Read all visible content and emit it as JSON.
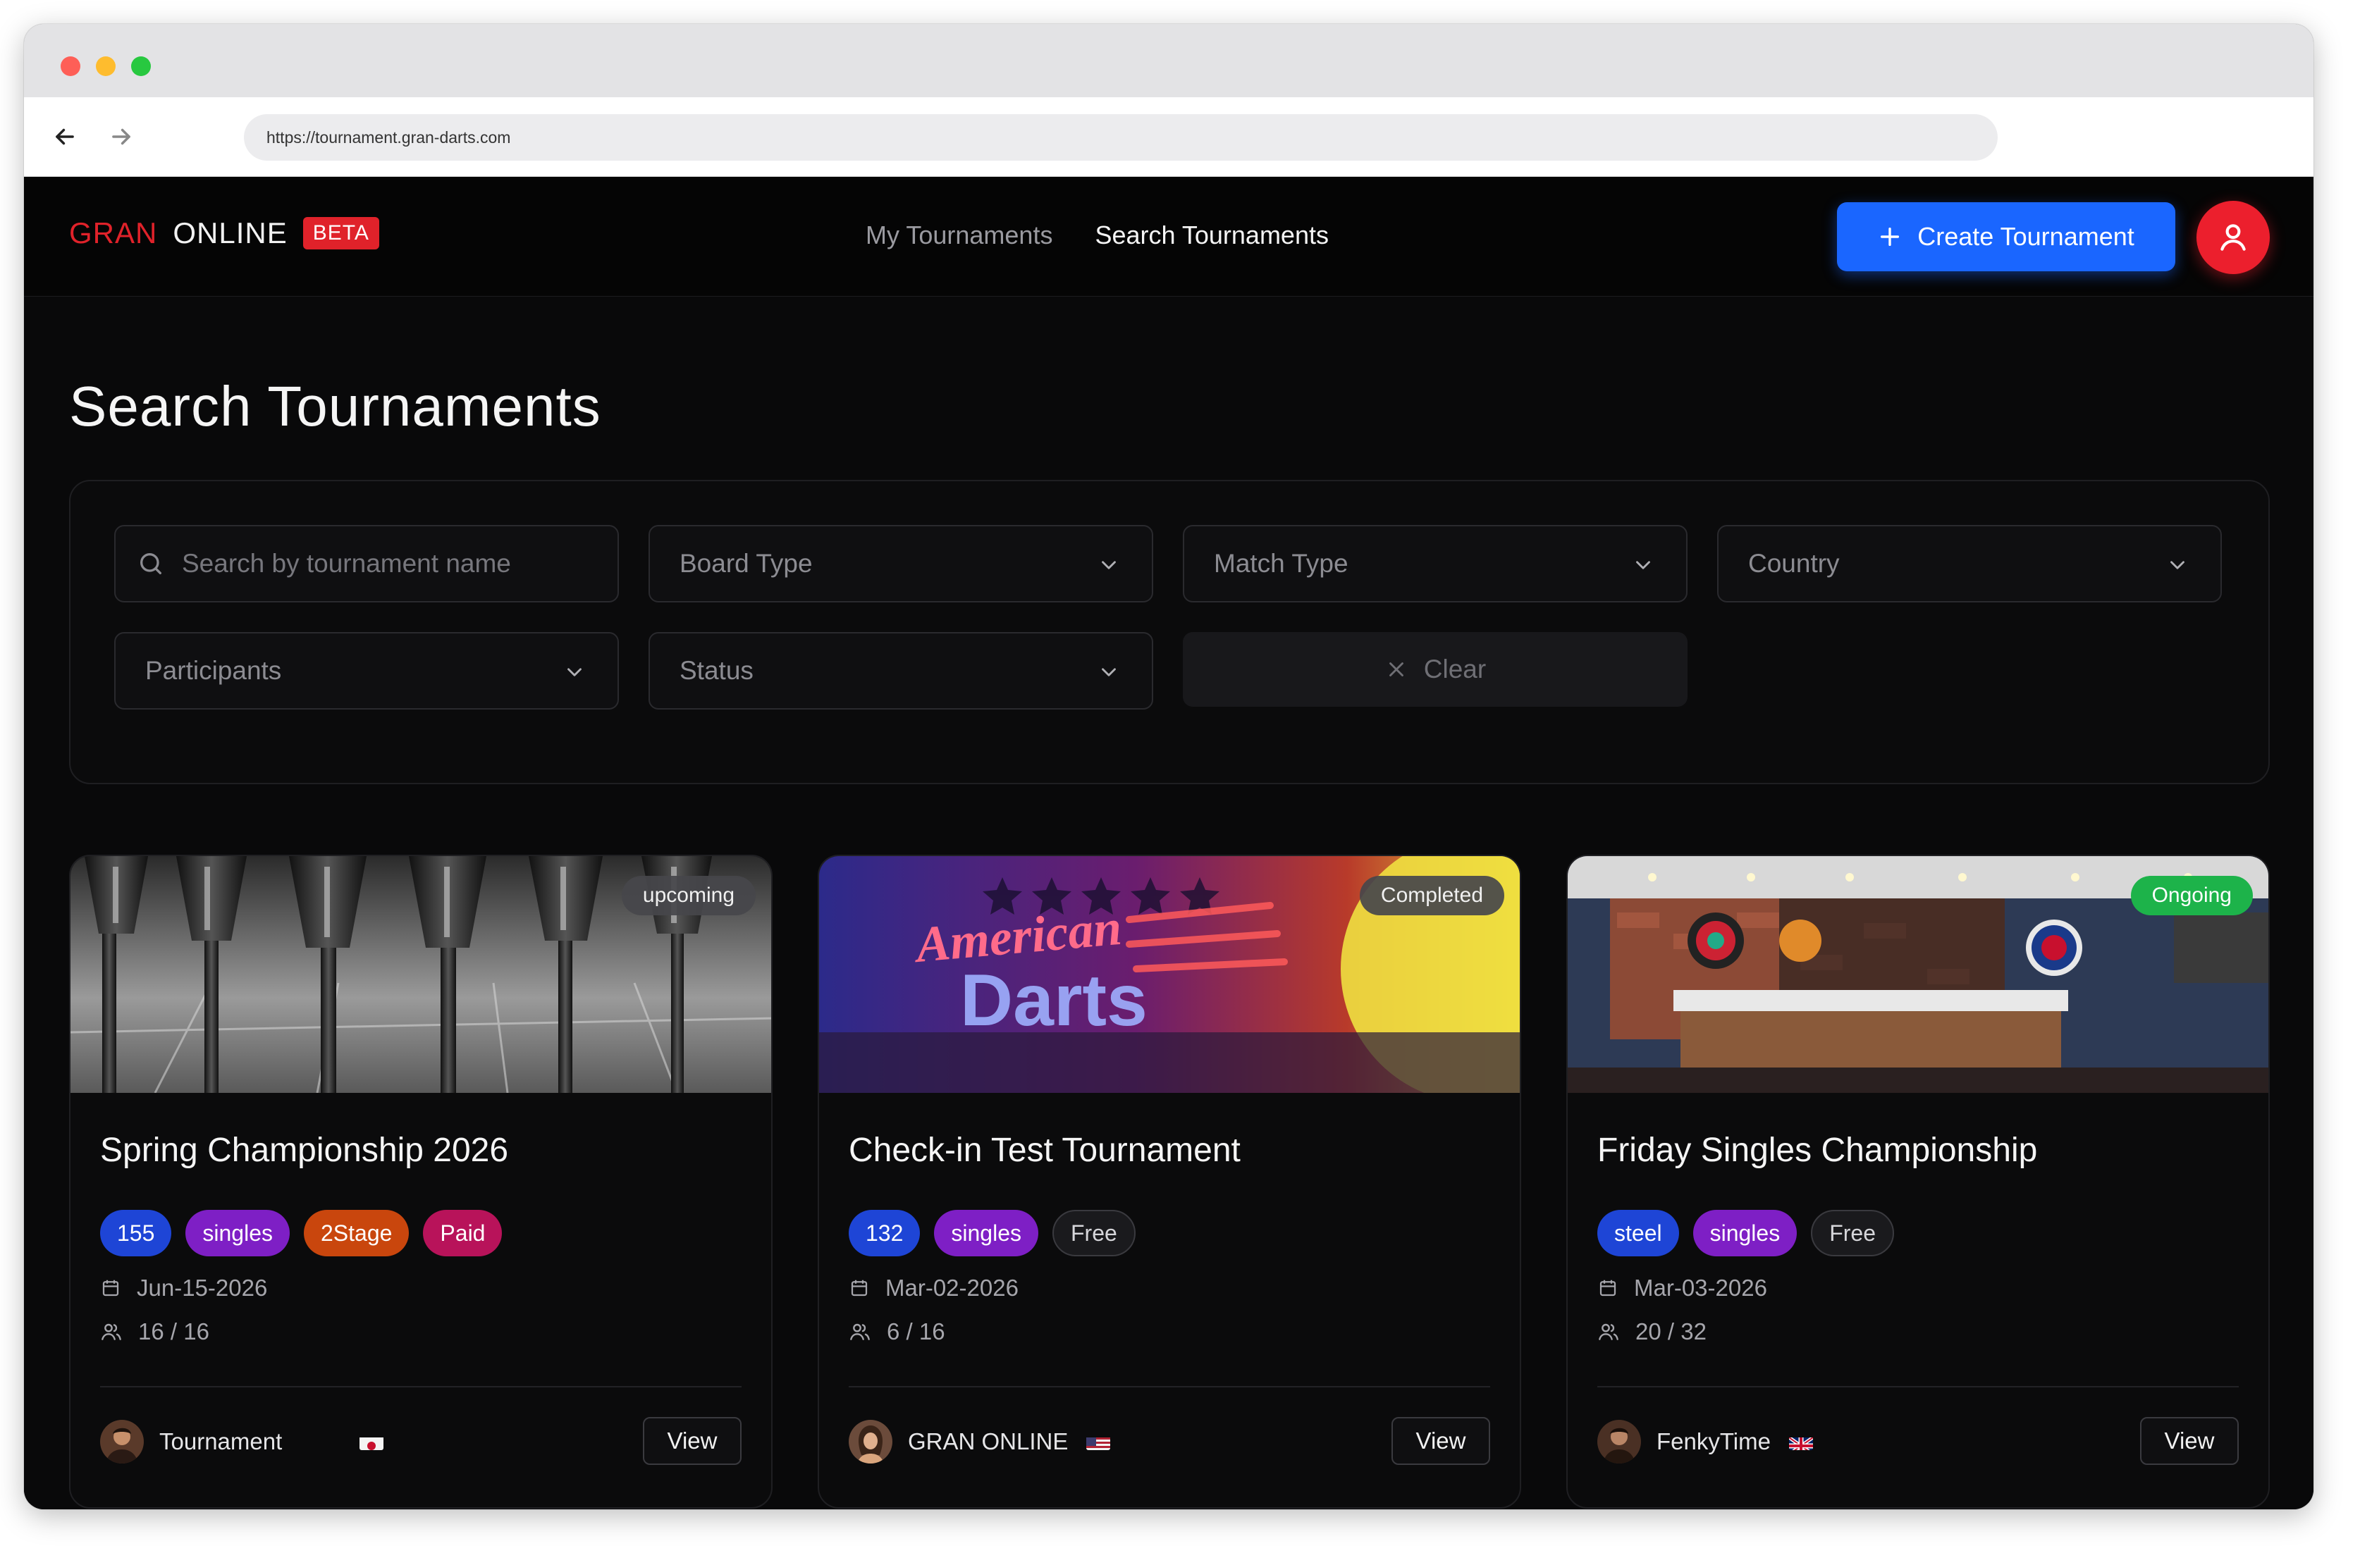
{
  "browser": {
    "url": "https://tournament.gran-darts.com"
  },
  "header": {
    "logo_gran": "GRAN",
    "logo_online": "ONLINE",
    "logo_beta": "BETA",
    "nav": [
      {
        "label": "My Tournaments",
        "active": false
      },
      {
        "label": "Search Tournaments",
        "active": true
      }
    ],
    "create_label": "Create Tournament"
  },
  "page": {
    "title": "Search Tournaments"
  },
  "filters": {
    "search_placeholder": "Search by tournament name",
    "board_type": "Board Type",
    "match_type": "Match Type",
    "country": "Country",
    "participants": "Participants",
    "status": "Status",
    "clear_label": "Clear"
  },
  "tournaments": [
    {
      "status": "upcoming",
      "title": "Spring Championship 2026",
      "tags": [
        "155",
        "singles",
        "2Stage",
        "Paid"
      ],
      "date": "Jun-15-2026",
      "participants": "16 / 16",
      "owner": "Tournament",
      "flag": "japan",
      "view_label": "View"
    },
    {
      "status": "Completed",
      "title": "Check-in Test Tournament",
      "tags": [
        "132",
        "singles",
        "Free"
      ],
      "date": "Mar-02-2026",
      "participants": "6 / 16",
      "owner": "GRAN ONLINE",
      "flag": "usa",
      "view_label": "View"
    },
    {
      "status": "Ongoing",
      "title": "Friday Singles Championship",
      "tags": [
        "steel",
        "singles",
        "Free"
      ],
      "date": "Mar-03-2026",
      "participants": "20 / 32",
      "owner": "FenkyTime",
      "flag": "uk",
      "view_label": "View"
    }
  ],
  "image_text": {
    "neon_line1": "American",
    "neon_line2": "Darts"
  },
  "colors": {
    "accent_red": "#e0222a",
    "primary_blue": "#1a66ff",
    "status_green": "#1db34a"
  }
}
